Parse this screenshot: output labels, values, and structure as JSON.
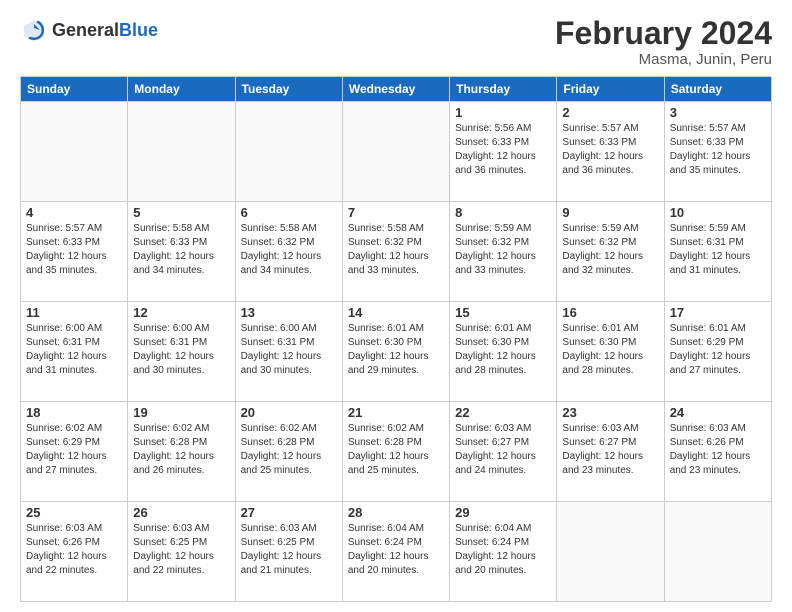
{
  "logo": {
    "general": "General",
    "blue": "Blue"
  },
  "header": {
    "title": "February 2024",
    "subtitle": "Masma, Junin, Peru"
  },
  "weekdays": [
    "Sunday",
    "Monday",
    "Tuesday",
    "Wednesday",
    "Thursday",
    "Friday",
    "Saturday"
  ],
  "weeks": [
    [
      {
        "day": "",
        "info": ""
      },
      {
        "day": "",
        "info": ""
      },
      {
        "day": "",
        "info": ""
      },
      {
        "day": "",
        "info": ""
      },
      {
        "day": "1",
        "info": "Sunrise: 5:56 AM\nSunset: 6:33 PM\nDaylight: 12 hours\nand 36 minutes."
      },
      {
        "day": "2",
        "info": "Sunrise: 5:57 AM\nSunset: 6:33 PM\nDaylight: 12 hours\nand 36 minutes."
      },
      {
        "day": "3",
        "info": "Sunrise: 5:57 AM\nSunset: 6:33 PM\nDaylight: 12 hours\nand 35 minutes."
      }
    ],
    [
      {
        "day": "4",
        "info": "Sunrise: 5:57 AM\nSunset: 6:33 PM\nDaylight: 12 hours\nand 35 minutes."
      },
      {
        "day": "5",
        "info": "Sunrise: 5:58 AM\nSunset: 6:33 PM\nDaylight: 12 hours\nand 34 minutes."
      },
      {
        "day": "6",
        "info": "Sunrise: 5:58 AM\nSunset: 6:32 PM\nDaylight: 12 hours\nand 34 minutes."
      },
      {
        "day": "7",
        "info": "Sunrise: 5:58 AM\nSunset: 6:32 PM\nDaylight: 12 hours\nand 33 minutes."
      },
      {
        "day": "8",
        "info": "Sunrise: 5:59 AM\nSunset: 6:32 PM\nDaylight: 12 hours\nand 33 minutes."
      },
      {
        "day": "9",
        "info": "Sunrise: 5:59 AM\nSunset: 6:32 PM\nDaylight: 12 hours\nand 32 minutes."
      },
      {
        "day": "10",
        "info": "Sunrise: 5:59 AM\nSunset: 6:31 PM\nDaylight: 12 hours\nand 31 minutes."
      }
    ],
    [
      {
        "day": "11",
        "info": "Sunrise: 6:00 AM\nSunset: 6:31 PM\nDaylight: 12 hours\nand 31 minutes."
      },
      {
        "day": "12",
        "info": "Sunrise: 6:00 AM\nSunset: 6:31 PM\nDaylight: 12 hours\nand 30 minutes."
      },
      {
        "day": "13",
        "info": "Sunrise: 6:00 AM\nSunset: 6:31 PM\nDaylight: 12 hours\nand 30 minutes."
      },
      {
        "day": "14",
        "info": "Sunrise: 6:01 AM\nSunset: 6:30 PM\nDaylight: 12 hours\nand 29 minutes."
      },
      {
        "day": "15",
        "info": "Sunrise: 6:01 AM\nSunset: 6:30 PM\nDaylight: 12 hours\nand 28 minutes."
      },
      {
        "day": "16",
        "info": "Sunrise: 6:01 AM\nSunset: 6:30 PM\nDaylight: 12 hours\nand 28 minutes."
      },
      {
        "day": "17",
        "info": "Sunrise: 6:01 AM\nSunset: 6:29 PM\nDaylight: 12 hours\nand 27 minutes."
      }
    ],
    [
      {
        "day": "18",
        "info": "Sunrise: 6:02 AM\nSunset: 6:29 PM\nDaylight: 12 hours\nand 27 minutes."
      },
      {
        "day": "19",
        "info": "Sunrise: 6:02 AM\nSunset: 6:28 PM\nDaylight: 12 hours\nand 26 minutes."
      },
      {
        "day": "20",
        "info": "Sunrise: 6:02 AM\nSunset: 6:28 PM\nDaylight: 12 hours\nand 25 minutes."
      },
      {
        "day": "21",
        "info": "Sunrise: 6:02 AM\nSunset: 6:28 PM\nDaylight: 12 hours\nand 25 minutes."
      },
      {
        "day": "22",
        "info": "Sunrise: 6:03 AM\nSunset: 6:27 PM\nDaylight: 12 hours\nand 24 minutes."
      },
      {
        "day": "23",
        "info": "Sunrise: 6:03 AM\nSunset: 6:27 PM\nDaylight: 12 hours\nand 23 minutes."
      },
      {
        "day": "24",
        "info": "Sunrise: 6:03 AM\nSunset: 6:26 PM\nDaylight: 12 hours\nand 23 minutes."
      }
    ],
    [
      {
        "day": "25",
        "info": "Sunrise: 6:03 AM\nSunset: 6:26 PM\nDaylight: 12 hours\nand 22 minutes."
      },
      {
        "day": "26",
        "info": "Sunrise: 6:03 AM\nSunset: 6:25 PM\nDaylight: 12 hours\nand 22 minutes."
      },
      {
        "day": "27",
        "info": "Sunrise: 6:03 AM\nSunset: 6:25 PM\nDaylight: 12 hours\nand 21 minutes."
      },
      {
        "day": "28",
        "info": "Sunrise: 6:04 AM\nSunset: 6:24 PM\nDaylight: 12 hours\nand 20 minutes."
      },
      {
        "day": "29",
        "info": "Sunrise: 6:04 AM\nSunset: 6:24 PM\nDaylight: 12 hours\nand 20 minutes."
      },
      {
        "day": "",
        "info": ""
      },
      {
        "day": "",
        "info": ""
      }
    ]
  ]
}
